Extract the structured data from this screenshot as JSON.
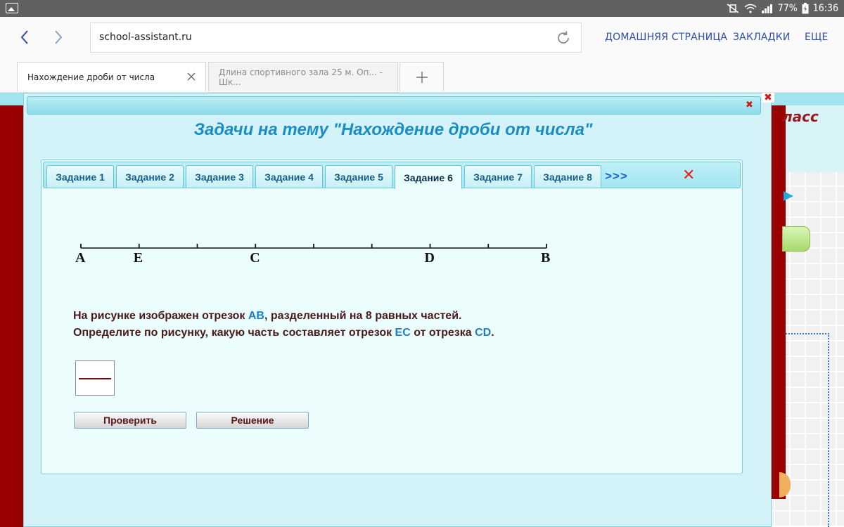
{
  "status_bar": {
    "battery": "77%",
    "time": "16:36"
  },
  "browser": {
    "url": "school-assistant.ru",
    "links": [
      "ДОМАШНЯЯ СТРАНИЦА",
      "ЗАКЛАДКИ",
      "ЕЩЕ"
    ],
    "tabs": [
      {
        "label": "Нахождение дроби от числа",
        "active": true
      },
      {
        "label": "Длина спортивного зала 25 м. Оп... - Шк...",
        "active": false
      }
    ]
  },
  "page": {
    "side_text": "ласс"
  },
  "modal": {
    "title": "Задачи на тему \"Нахождение дроби от числа\"",
    "task_tabs": [
      "Задание 1",
      "Задание 2",
      "Задание 3",
      "Задание 4",
      "Задание 5",
      "Задание 6",
      "Задание 7",
      "Задание 8"
    ],
    "active_task": 5,
    "more_label": ">>>",
    "close_glyph": "✕",
    "segment": {
      "divisions": 8,
      "points": [
        {
          "label": "A",
          "division": 0
        },
        {
          "label": "E",
          "division": 1
        },
        {
          "label": "C",
          "division": 3
        },
        {
          "label": "D",
          "division": 6
        },
        {
          "label": "B",
          "division": 8
        }
      ]
    },
    "question": {
      "line1_prefix": "На рисунке изображен отрезок ",
      "line1_hl": "AB",
      "line1_suffix": ", разделенный на 8 равных частей.",
      "line2_prefix": "Определите по рисунку, какую часть составляет отрезок ",
      "line2_hl1": "EC",
      "line2_mid": " от отрезка ",
      "line2_hl2": "CD",
      "line2_suffix": "."
    },
    "answer": {
      "numerator": "",
      "denominator": ""
    },
    "buttons": {
      "check": "Проверить",
      "solution": "Решение"
    }
  }
}
